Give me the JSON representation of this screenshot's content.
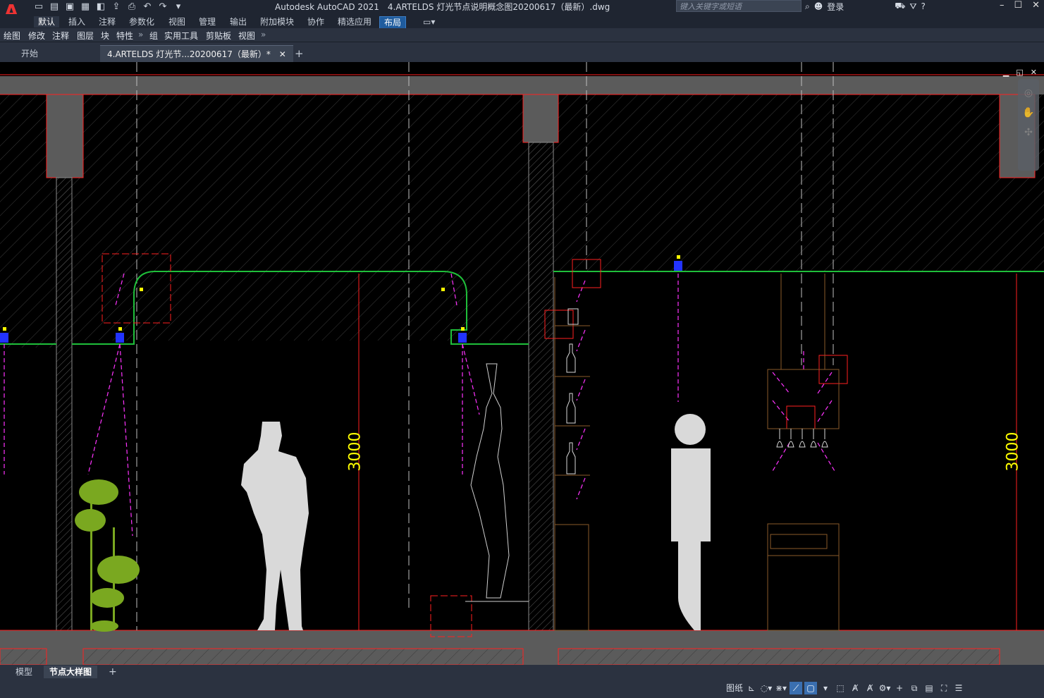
{
  "window": {
    "app_title": "Autodesk AutoCAD 2021",
    "doc_title": "4.ARTELDS 灯光节点说明概念图20200617（最新）.dwg",
    "search_placeholder": "键入关键字或短语",
    "login_label": "登录"
  },
  "quick_access": [
    "new-icon",
    "open-icon",
    "save-icon",
    "save-as-icon",
    "web-open-icon",
    "export-icon",
    "print-icon",
    "undo-icon",
    "redo-icon",
    "customize-icon"
  ],
  "ribbon_tabs": [
    "默认",
    "插入",
    "注释",
    "参数化",
    "视图",
    "管理",
    "输出",
    "附加模块",
    "协作",
    "精选应用",
    "布局"
  ],
  "ribbon_panels": [
    "绘图",
    "修改",
    "注释",
    "图层",
    "块",
    "特性",
    "组",
    "实用工具",
    "剪贴板",
    "视图"
  ],
  "doc_tabs": {
    "start": "开始",
    "current": "4.ARTELDS 灯光节...20200617（最新）*"
  },
  "dimensions": [
    "3000",
    "3000"
  ],
  "layout_tabs": {
    "model": "模型",
    "layout": "节点大样图",
    "add": "+"
  },
  "status": {
    "paper_label": "图纸"
  },
  "colors": {
    "section_border": "#ff2020",
    "ceiling_line": "#1fbf3a",
    "light_ray": "#ff33ff",
    "dimension": "#ffff00",
    "figure": "#d9d9d9",
    "furniture": "#8a5a2a",
    "accent_tab": "#1f5c9e"
  }
}
